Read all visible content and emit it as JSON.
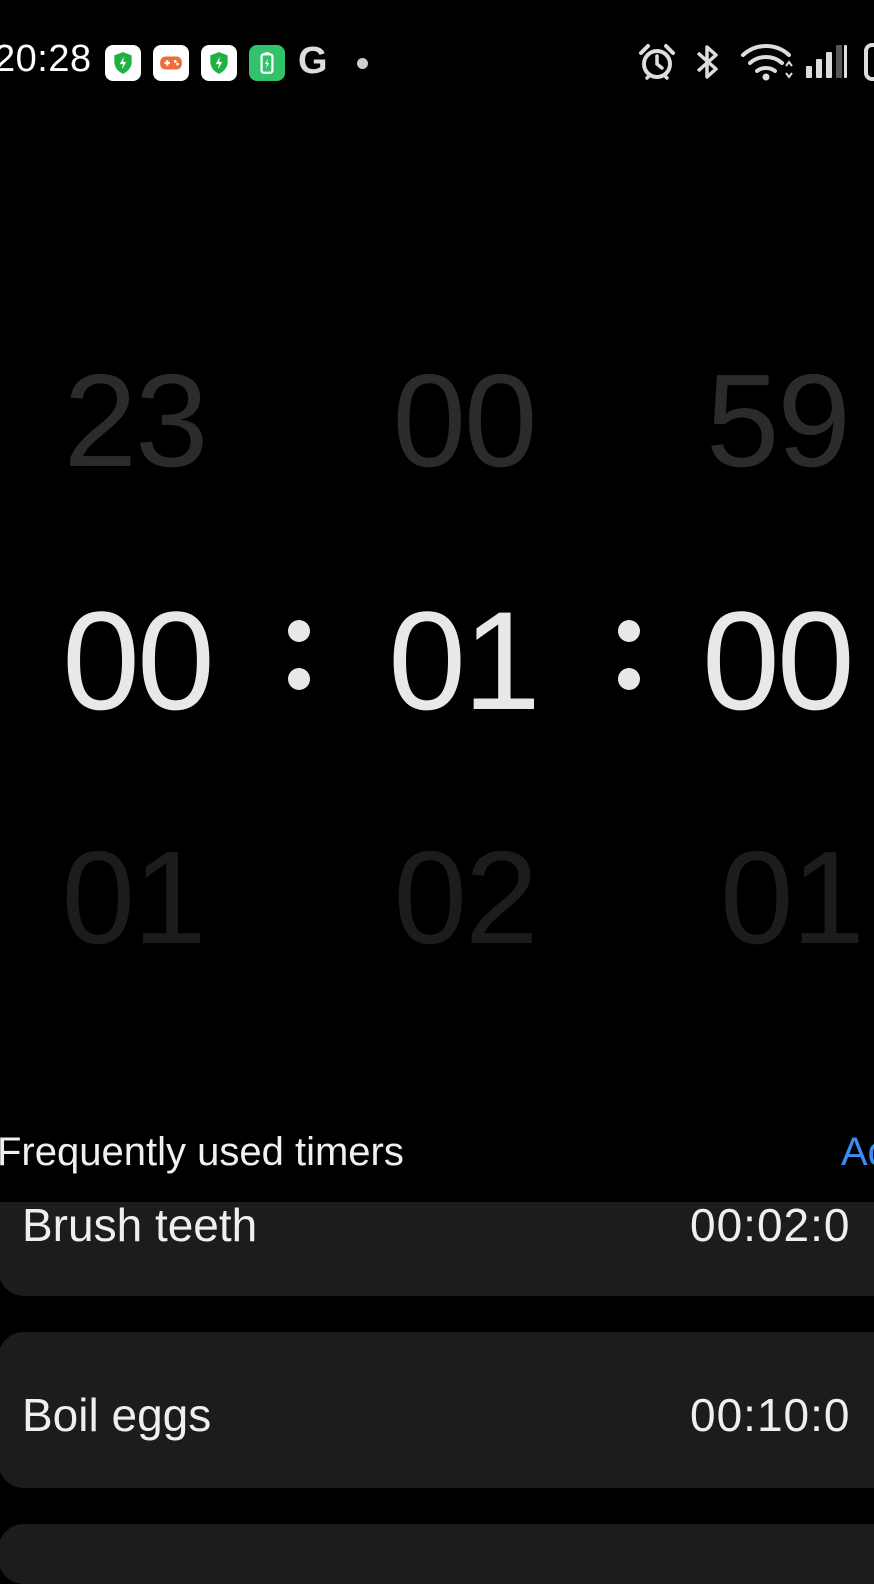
{
  "status_bar": {
    "time": "20:28",
    "notification_icons": [
      "shield-icon",
      "game-icon",
      "shield-icon",
      "battery-saver-icon",
      "google-icon"
    ],
    "google_letter": "G",
    "system_icons": [
      "alarm-icon",
      "bluetooth-icon",
      "wifi-icon",
      "signal-icon",
      "battery-icon"
    ]
  },
  "picker": {
    "hours": {
      "prev": "23",
      "current": "00",
      "next": "01"
    },
    "minutes": {
      "prev": "00",
      "current": "01",
      "next": "02"
    },
    "seconds": {
      "prev": "59",
      "current": "00",
      "next": "01"
    }
  },
  "frequent": {
    "title": "Frequently used timers",
    "add_label": "Ad",
    "items": [
      {
        "name": "Brush teeth",
        "duration": "00:02:0"
      },
      {
        "name": "Boil eggs",
        "duration": "00:10:0"
      }
    ]
  },
  "colors": {
    "accent": "#3d8bf0",
    "card": "#1c1c1c",
    "background": "#000000"
  }
}
